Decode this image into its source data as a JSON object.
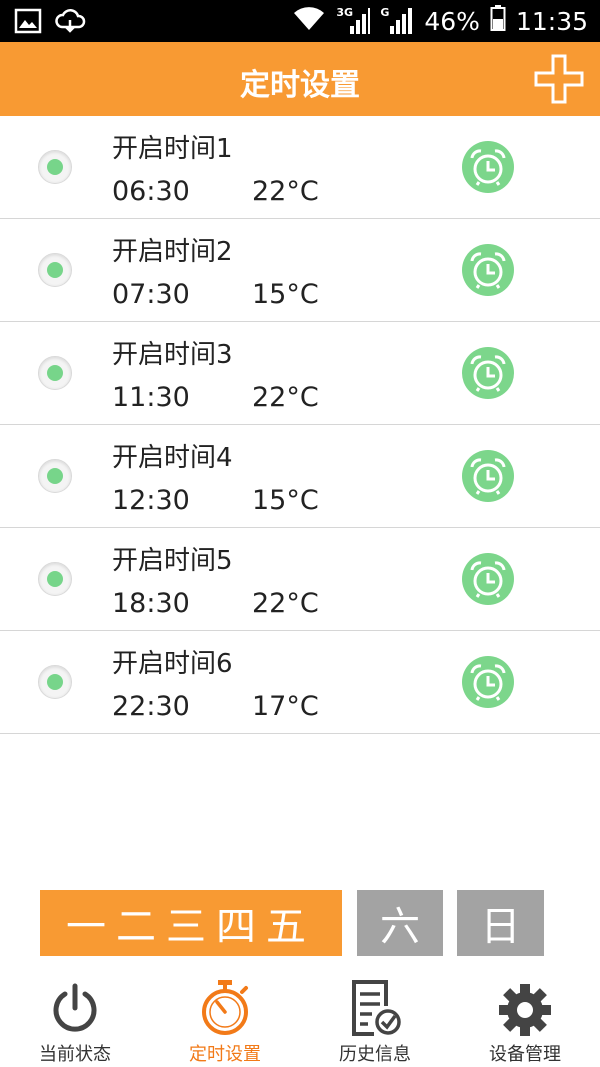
{
  "status_bar": {
    "battery": "46%",
    "time": "11:35",
    "network_a": "3G",
    "network_b": "G"
  },
  "header": {
    "title": "定时设置",
    "add_icon": "plus-icon"
  },
  "timers": [
    {
      "name": "开启时间1",
      "time": "06:30",
      "temp": "22°C"
    },
    {
      "name": "开启时间2",
      "time": "07:30",
      "temp": "15°C"
    },
    {
      "name": "开启时间3",
      "time": "11:30",
      "temp": "22°C"
    },
    {
      "name": "开启时间4",
      "time": "12:30",
      "temp": "15°C"
    },
    {
      "name": "开启时间5",
      "time": "18:30",
      "temp": "22°C"
    },
    {
      "name": "开启时间6",
      "time": "22:30",
      "temp": "17°C"
    }
  ],
  "days": {
    "weekdays": "一二三四五",
    "saturday": "六",
    "sunday": "日"
  },
  "tabs": [
    {
      "label": "当前状态",
      "icon": "power-icon"
    },
    {
      "label": "定时设置",
      "icon": "stopwatch-icon",
      "active": true
    },
    {
      "label": "历史信息",
      "icon": "document-check-icon"
    },
    {
      "label": "设备管理",
      "icon": "gear-icon"
    }
  ],
  "colors": {
    "accent": "#f89a33",
    "active_tab": "#f27a18",
    "alarm_green": "#7cd68b",
    "inactive_day": "#a3a3a3"
  }
}
